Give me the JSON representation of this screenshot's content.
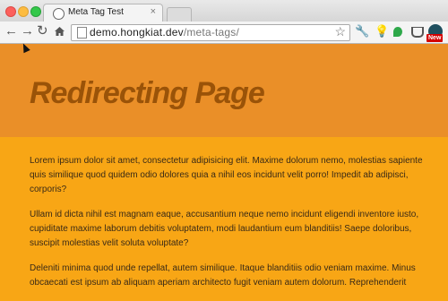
{
  "browser": {
    "tab_title": "Meta Tag Test",
    "tab_close": "×",
    "url_host": "demo.hongkiat.dev",
    "url_path": "/meta-tags/",
    "icons": [
      "back-icon",
      "forward-icon",
      "reload-icon",
      "home-icon",
      "bookmark-star-icon",
      "wrench-icon",
      "lightbulb-icon",
      "evernote-icon",
      "pocket-icon",
      "extension-new-icon"
    ],
    "extension_badge": "New",
    "colors": {
      "close": "#fc605c",
      "minimize": "#fdbc40",
      "maximize": "#34c84a"
    }
  },
  "page": {
    "title": "Redirecting Page",
    "paragraphs": [
      "Lorem ipsum dolor sit amet, consectetur adipisicing elit. Maxime dolorum nemo, molestias sapiente quis similique quod quidem odio dolores quia a nihil eos incidunt velit porro! Impedit ab adipisci, corporis?",
      "Ullam id dicta nihil est magnam eaque, accusantium neque nemo incidunt eligendi inventore iusto, cupiditate maxime laborum debitis voluptatem, modi laudantium eum blanditiis! Saepe doloribus, suscipit molestias velit soluta voluptate?",
      "Deleniti minima quod unde repellat, autem similique. Itaque blanditiis odio veniam maxime. Minus obcaecati est ipsum ab aliquam aperiam architecto fugit veniam autem dolorum. Reprehenderit"
    ],
    "colors": {
      "hero_background": "#ea8f28",
      "body_background": "#f8a615",
      "title_color": "#9a5308"
    }
  }
}
